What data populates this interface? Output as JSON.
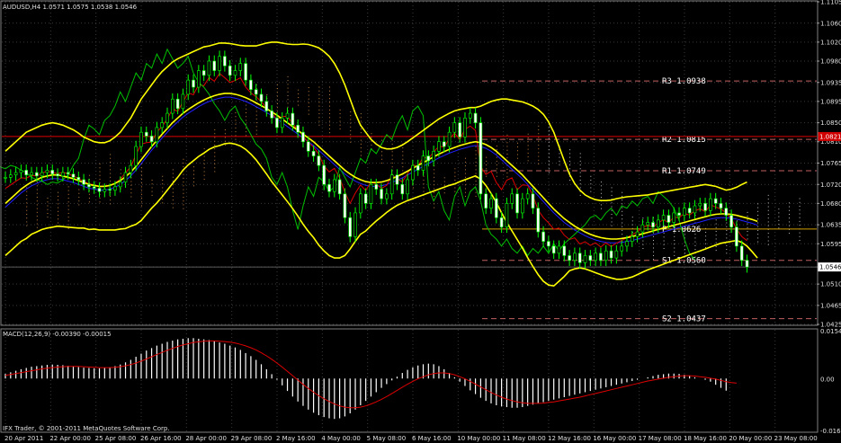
{
  "header": {
    "symbol": "AUDUSD,H4",
    "quote": "1.0571 1.0575 1.0538 1.0546"
  },
  "macd_header": "MACD(12,26,9) -0.00390 -0.00015",
  "footer": "IFX Trader, © 2001-2011 MetaQuotes Software Corp.",
  "colors": {
    "background": "#000000",
    "grid": "#3a3a3a",
    "candle": "#00ff00",
    "bollinger": "#ffff00",
    "ema_red": "#dd0000",
    "ema_blue": "#2020ff",
    "chikou": "#00c000",
    "cloud_up": "#c08040",
    "cloud_down": "#c0c0c0",
    "pivot_dash": "#c06060",
    "pivot_p": "#d0a000",
    "histogram": "#ffffff",
    "signal": "#dd0000",
    "marker_red": "#d00000"
  },
  "chart_data": {
    "type": "candlestick",
    "ylim": [
      1.0425,
      1.1105
    ],
    "y_ticks": [
      "1.1105",
      "1.1060",
      "1.1020",
      "1.0980",
      "1.0935",
      "1.0895",
      "1.0850",
      "1.0810",
      "1.0765",
      "1.0720",
      "1.0680",
      "1.0635",
      "1.0595",
      "1.0546",
      "1.0510",
      "1.0465",
      "1.0425"
    ],
    "x_ticks": [
      "20 Apr 2011",
      "22 Apr 00:00",
      "25 Apr 08:00",
      "26 Apr 16:00",
      "28 Apr 00:00",
      "29 Apr 08:00",
      "2 May 16:00",
      "4 May 00:00",
      "5 May 08:00",
      "6 May 16:00",
      "10 May 00:00",
      "11 May 08:00",
      "12 May 16:00",
      "16 May 00:00",
      "17 May 08:00",
      "18 May 16:00",
      "20 May 00:00",
      "23 May 08:00"
    ],
    "close": [
      1.0735,
      1.074,
      1.0745,
      1.075,
      1.074,
      1.0745,
      1.0738,
      1.0745,
      1.075,
      1.0742,
      1.0738,
      1.0745,
      1.0742,
      1.0735,
      1.073,
      1.072,
      1.0715,
      1.0712,
      1.0705,
      1.071,
      1.0708,
      1.0715,
      1.0725,
      1.0745,
      1.076,
      1.08,
      1.083,
      1.0822,
      1.081,
      1.084,
      1.085,
      1.087,
      1.09,
      1.088,
      1.091,
      1.094,
      1.0925,
      1.096,
      1.095,
      1.098,
      1.096,
      1.099,
      1.097,
      1.095,
      1.096,
      1.0975,
      1.094,
      1.092,
      1.091,
      1.0895,
      1.0875,
      1.086,
      1.084,
      1.086,
      1.087,
      1.0845,
      1.083,
      1.081,
      1.079,
      1.078,
      1.076,
      1.072,
      1.0705,
      1.073,
      1.07,
      1.065,
      1.061,
      1.066,
      1.07,
      1.068,
      1.072,
      1.071,
      1.069,
      1.07,
      1.074,
      1.072,
      1.07,
      1.073,
      1.076,
      1.075,
      1.078,
      1.077,
      1.079,
      1.081,
      1.08,
      1.083,
      1.085,
      1.082,
      1.086,
      1.087,
      1.085,
      1.07,
      1.067,
      1.069,
      1.065,
      1.063,
      1.068,
      1.07,
      1.066,
      1.069,
      1.07,
      1.067,
      1.062,
      1.06,
      1.059,
      1.0575,
      1.059,
      1.057,
      1.056,
      1.0575,
      1.0555,
      1.057,
      1.056,
      1.0575,
      1.056,
      1.058,
      1.0565,
      1.058,
      1.059,
      1.06,
      1.061,
      1.062,
      1.0635,
      1.064,
      1.063,
      1.0645,
      1.0655,
      1.064,
      1.066,
      1.0655,
      1.067,
      1.066,
      1.0675,
      1.068,
      1.0665,
      1.069,
      1.068,
      1.067,
      1.0655,
      1.063,
      1.059,
      1.056,
      1.0546
    ],
    "bb_upper": [
      1.079,
      1.08,
      1.081,
      1.082,
      1.083,
      1.0835,
      1.084,
      1.0845,
      1.0848,
      1.085,
      1.0848,
      1.0845,
      1.084,
      1.0835,
      1.0828,
      1.082,
      1.0815,
      1.081,
      1.0808,
      1.0808,
      1.0812,
      1.082,
      1.083,
      1.0845,
      1.086,
      1.088,
      1.09,
      1.0915,
      1.093,
      1.0945,
      1.0958,
      1.0968,
      1.0978,
      1.0985,
      1.099,
      1.0995,
      1.1,
      1.1005,
      1.101,
      1.1012,
      1.1015,
      1.1018,
      1.1018,
      1.1017,
      1.1015,
      1.1013,
      1.1012,
      1.1012,
      1.1012,
      1.1015,
      1.1018,
      1.102,
      1.102,
      1.1018,
      1.1016,
      1.1015,
      1.1015,
      1.1016,
      1.1015,
      1.1012,
      1.1008,
      1.1,
      1.099,
      1.0975,
      1.0955,
      1.093,
      1.09,
      1.087,
      1.0845,
      1.083,
      1.0815,
      1.0805,
      1.0798,
      1.0795,
      1.0795,
      1.0798,
      1.0803,
      1.081,
      1.0818,
      1.0826,
      1.0834,
      1.0842,
      1.085,
      1.0858,
      1.0864,
      1.087,
      1.0875,
      1.0878,
      1.088,
      1.0882,
      1.0882,
      1.0885,
      1.089,
      1.0895,
      1.0898,
      1.09,
      1.09,
      1.0898,
      1.0896,
      1.0894,
      1.089,
      1.0885,
      1.0878,
      1.0868,
      1.0852,
      1.083,
      1.08,
      1.077,
      1.0742,
      1.0722,
      1.0708,
      1.0698,
      1.0692,
      1.0688,
      1.0686,
      1.0686,
      1.0687,
      1.069,
      1.0692,
      1.0694,
      1.0695,
      1.0696,
      1.0697,
      1.0698,
      1.07,
      1.0702,
      1.0704,
      1.0706,
      1.0708,
      1.071,
      1.0712,
      1.0714,
      1.0716,
      1.0718,
      1.072,
      1.0718,
      1.0716,
      1.0712,
      1.0708,
      1.071,
      1.0714,
      1.072,
      1.0725
    ],
    "bb_mid": [
      1.068,
      1.069,
      1.07,
      1.071,
      1.0718,
      1.0725,
      1.073,
      1.0735,
      1.0738,
      1.074,
      1.074,
      1.0738,
      1.0735,
      1.0732,
      1.0728,
      1.0724,
      1.072,
      1.0718,
      1.0716,
      1.0716,
      1.0718,
      1.0722,
      1.0728,
      1.0736,
      1.0746,
      1.0758,
      1.0772,
      1.0786,
      1.08,
      1.0813,
      1.0826,
      1.0838,
      1.085,
      1.086,
      1.087,
      1.0878,
      1.0885,
      1.0892,
      1.0898,
      1.0903,
      1.0907,
      1.091,
      1.0912,
      1.0912,
      1.091,
      1.0907,
      1.0903,
      1.0898,
      1.0892,
      1.0886,
      1.088,
      1.0873,
      1.0866,
      1.0858,
      1.085,
      1.0842,
      1.0834,
      1.0826,
      1.0818,
      1.081,
      1.08,
      1.079,
      1.078,
      1.077,
      1.076,
      1.075,
      1.0742,
      1.0735,
      1.073,
      1.0726,
      1.0724,
      1.0724,
      1.0725,
      1.0728,
      1.0732,
      1.0737,
      1.0742,
      1.0748,
      1.0754,
      1.076,
      1.0766,
      1.0772,
      1.0778,
      1.0784,
      1.0789,
      1.0794,
      1.0798,
      1.0802,
      1.0805,
      1.0808,
      1.081,
      1.0808,
      1.0804,
      1.0798,
      1.079,
      1.078,
      1.077,
      1.076,
      1.075,
      1.074,
      1.0728,
      1.0716,
      1.0704,
      1.0692,
      1.068,
      1.0668,
      1.0658,
      1.0648,
      1.064,
      1.0632,
      1.0626,
      1.062,
      1.0615,
      1.0611,
      1.0608,
      1.0606,
      1.0605,
      1.0605,
      1.0606,
      1.0608,
      1.061,
      1.0613,
      1.0616,
      1.0619,
      1.0622,
      1.0625,
      1.0628,
      1.0631,
      1.0634,
      1.0637,
      1.064,
      1.0643,
      1.0646,
      1.0649,
      1.0652,
      1.0655,
      1.0657,
      1.0658,
      1.0658,
      1.0657,
      1.0655,
      1.0652,
      1.0649,
      1.0646,
      1.0642
    ],
    "bb_lower": [
      1.057,
      1.058,
      1.059,
      1.06,
      1.0606,
      1.0615,
      1.062,
      1.0625,
      1.0628,
      1.063,
      1.0632,
      1.0631,
      1.063,
      1.0629,
      1.0628,
      1.0628,
      1.0625,
      1.0626,
      1.0624,
      1.0624,
      1.0624,
      1.0624,
      1.0626,
      1.0627,
      1.0632,
      1.0636,
      1.0644,
      1.0657,
      1.067,
      1.0681,
      1.0694,
      1.0708,
      1.0722,
      1.0735,
      1.075,
      1.0761,
      1.077,
      1.0779,
      1.0786,
      1.0794,
      1.0799,
      1.0802,
      1.0806,
      1.0807,
      1.0805,
      1.0801,
      1.0794,
      1.0784,
      1.0772,
      1.0757,
      1.0742,
      1.0726,
      1.0712,
      1.0698,
      1.0684,
      1.0669,
      1.0653,
      1.0636,
      1.0621,
      1.0608,
      1.0592,
      1.058,
      1.057,
      1.0565,
      1.0565,
      1.057,
      1.0584,
      1.06,
      1.0615,
      1.0622,
      1.0633,
      1.0643,
      1.0652,
      1.0661,
      1.0669,
      1.0676,
      1.0681,
      1.0686,
      1.069,
      1.0694,
      1.0698,
      1.0702,
      1.0706,
      1.071,
      1.0714,
      1.0718,
      1.0721,
      1.0726,
      1.073,
      1.0734,
      1.0738,
      1.0731,
      1.0718,
      1.0701,
      1.0682,
      1.066,
      1.064,
      1.0622,
      1.0604,
      1.0586,
      1.0566,
      1.0547,
      1.053,
      1.0516,
      1.0508,
      1.0506,
      1.0516,
      1.0526,
      1.0538,
      1.0542,
      1.0544,
      1.0542,
      1.0538,
      1.0534,
      1.053,
      1.0526,
      1.0523,
      1.052,
      1.052,
      1.0522,
      1.0525,
      1.053,
      1.0535,
      1.054,
      1.0544,
      1.0548,
      1.0552,
      1.0556,
      1.056,
      1.0564,
      1.0568,
      1.0572,
      1.0576,
      1.058,
      1.0584,
      1.0588,
      1.0592,
      1.0596,
      1.0598,
      1.06,
      1.0602,
      1.0598,
      1.059,
      1.0578,
      1.0565
    ],
    "pivots": [
      {
        "name": "R3",
        "value": 1.0938,
        "label": "R3  1.0938"
      },
      {
        "name": "R2",
        "value": 1.0815,
        "label": "R2  1.0815"
      },
      {
        "name": "R1",
        "value": 1.0749,
        "label": "R1  1.0749"
      },
      {
        "name": "P",
        "value": 1.0626,
        "label": "P  1.0626"
      },
      {
        "name": "S1",
        "value": 1.056,
        "label": "S1  1.0560"
      },
      {
        "name": "S2",
        "value": 1.0437,
        "label": "S2  1.0437"
      }
    ],
    "price_markers": [
      {
        "value": 1.0546,
        "label": "1.0546",
        "color": "#ffffff",
        "text": "#000000"
      },
      {
        "value": 1.0821,
        "label": "1.0821",
        "color": "#d00000",
        "text": "#ffffff"
      }
    ],
    "macd": {
      "ylim": [
        -0.0167,
        0.0154
      ],
      "y_ticks": [
        "0.01541",
        "0.00",
        "-0.01670"
      ],
      "histogram": [
        0.0015,
        0.002,
        0.0025,
        0.003,
        0.0034,
        0.0038,
        0.004,
        0.0042,
        0.0044,
        0.0045,
        0.0044,
        0.0043,
        0.0041,
        0.0039,
        0.0037,
        0.0035,
        0.0034,
        0.0033,
        0.0033,
        0.0034,
        0.0036,
        0.004,
        0.0045,
        0.0052,
        0.006,
        0.007,
        0.008,
        0.009,
        0.0098,
        0.0106,
        0.0112,
        0.0118,
        0.0122,
        0.0126,
        0.0128,
        0.013,
        0.013,
        0.0128,
        0.0126,
        0.0124,
        0.012,
        0.0116,
        0.0112,
        0.0106,
        0.01,
        0.0092,
        0.0082,
        0.0072,
        0.006,
        0.0046,
        0.003,
        0.0014,
        -0.0004,
        -0.0022,
        -0.004,
        -0.0058,
        -0.0074,
        -0.0088,
        -0.01,
        -0.011,
        -0.0118,
        -0.0124,
        -0.0128,
        -0.013,
        -0.0128,
        -0.0122,
        -0.0112,
        -0.01,
        -0.0086,
        -0.0072,
        -0.0058,
        -0.0044,
        -0.003,
        -0.0018,
        -0.0006,
        0.0006,
        0.0018,
        0.0028,
        0.0036,
        0.0042,
        0.0046,
        0.0048,
        0.0046,
        0.004,
        0.003,
        0.0018,
        0.0004,
        -0.001,
        -0.0024,
        -0.0038,
        -0.005,
        -0.0062,
        -0.0072,
        -0.008,
        -0.0086,
        -0.009,
        -0.0092,
        -0.0094,
        -0.0094,
        -0.0092,
        -0.0088,
        -0.0084,
        -0.008,
        -0.0076,
        -0.0072,
        -0.0068,
        -0.0064,
        -0.006,
        -0.0056,
        -0.0052,
        -0.0048,
        -0.0044,
        -0.004,
        -0.0036,
        -0.0032,
        -0.0028,
        -0.0024,
        -0.002,
        -0.0016,
        -0.0012,
        -0.0008,
        -0.0004,
        0.0,
        0.0004,
        0.0008,
        0.0012,
        0.0014,
        0.0016,
        0.0016,
        0.0015,
        0.0012,
        0.0008,
        0.0004,
        0.0,
        -0.0004,
        -0.001,
        -0.002,
        -0.003,
        -0.0039
      ],
      "signal": [
        0.001,
        0.0013,
        0.0016,
        0.0019,
        0.0022,
        0.0025,
        0.0028,
        0.0031,
        0.0033,
        0.0035,
        0.0037,
        0.0038,
        0.0039,
        0.0039,
        0.0039,
        0.0038,
        0.0037,
        0.0036,
        0.0035,
        0.0035,
        0.0035,
        0.0036,
        0.0038,
        0.0041,
        0.0045,
        0.005,
        0.0056,
        0.0063,
        0.007,
        0.0077,
        0.0084,
        0.0091,
        0.0097,
        0.0103,
        0.0108,
        0.0112,
        0.0116,
        0.0118,
        0.012,
        0.0121,
        0.0121,
        0.012,
        0.0119,
        0.0117,
        0.0114,
        0.011,
        0.0105,
        0.0099,
        0.0092,
        0.0083,
        0.0073,
        0.0062,
        0.005,
        0.0037,
        0.0023,
        0.0009,
        -0.0005,
        -0.0019,
        -0.0032,
        -0.0044,
        -0.0055,
        -0.0065,
        -0.0074,
        -0.0082,
        -0.0088,
        -0.0092,
        -0.0094,
        -0.0094,
        -0.0092,
        -0.0088,
        -0.0082,
        -0.0075,
        -0.0067,
        -0.0058,
        -0.0048,
        -0.0038,
        -0.0028,
        -0.0018,
        -0.0009,
        -0.0001,
        0.0006,
        0.0012,
        0.0016,
        0.0018,
        0.0018,
        0.0016,
        0.0012,
        0.0006,
        -0.0001,
        -0.0009,
        -0.0018,
        -0.0027,
        -0.0036,
        -0.0045,
        -0.0053,
        -0.006,
        -0.0066,
        -0.0071,
        -0.0075,
        -0.0078,
        -0.008,
        -0.008,
        -0.008,
        -0.0079,
        -0.0077,
        -0.0075,
        -0.0072,
        -0.0069,
        -0.0066,
        -0.0063,
        -0.006,
        -0.0056,
        -0.0052,
        -0.0048,
        -0.0044,
        -0.004,
        -0.0036,
        -0.0032,
        -0.0028,
        -0.0024,
        -0.002,
        -0.0016,
        -0.0012,
        -0.0008,
        -0.0005,
        -0.0002,
        0.0001,
        0.0004,
        0.0006,
        0.0008,
        0.0009,
        0.0009,
        0.0008,
        0.0006,
        0.0004,
        0.0001,
        -0.0002,
        -0.0006,
        -0.001,
        -0.0013,
        -0.0015
      ]
    }
  }
}
